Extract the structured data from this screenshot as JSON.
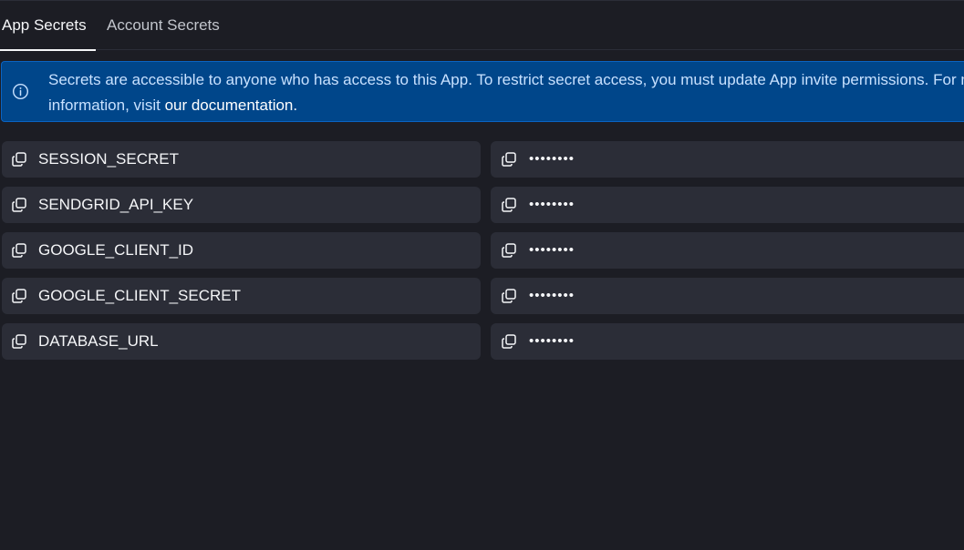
{
  "tabs": [
    {
      "label": "App Secrets",
      "active": true
    },
    {
      "label": "Account Secrets",
      "active": false
    }
  ],
  "banner": {
    "icon": "info-icon",
    "message": "Secrets are accessible to anyone who has access to this App. To restrict secret access, you must update App invite permissions. For more information, visit",
    "link_text": "our documentation.",
    "color": "#00468a"
  },
  "secrets": [
    {
      "key": "SESSION_SECRET",
      "value": "••••••••"
    },
    {
      "key": "SENDGRID_API_KEY",
      "value": "••••••••"
    },
    {
      "key": "GOOGLE_CLIENT_ID",
      "value": "••••••••"
    },
    {
      "key": "GOOGLE_CLIENT_SECRET",
      "value": "••••••••"
    },
    {
      "key": "DATABASE_URL",
      "value": "••••••••"
    }
  ],
  "icons": {
    "copy": "copy-icon"
  }
}
